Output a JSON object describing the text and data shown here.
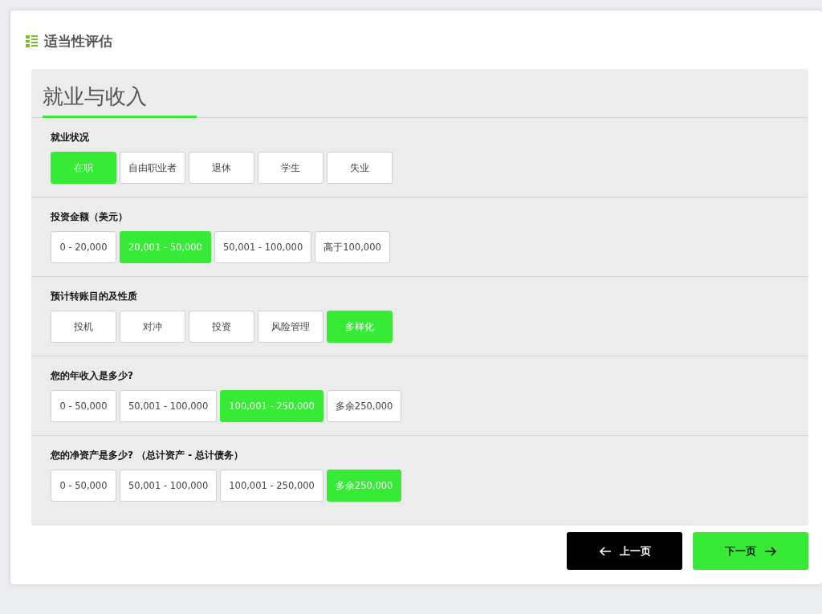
{
  "page": {
    "title": "适当性评估"
  },
  "panel": {
    "heading": "就业与收入"
  },
  "questions": [
    {
      "label": "就业状况",
      "options": [
        {
          "label": "在职",
          "selected": true
        },
        {
          "label": "自由职业者",
          "selected": false
        },
        {
          "label": "退休",
          "selected": false
        },
        {
          "label": "学生",
          "selected": false
        },
        {
          "label": "失业",
          "selected": false
        }
      ]
    },
    {
      "label": "投资金额（美元）",
      "options": [
        {
          "label": "0 - 20,000",
          "selected": false
        },
        {
          "label": "20,001 - 50,000",
          "selected": true
        },
        {
          "label": "50,001 - 100,000",
          "selected": false
        },
        {
          "label": "高于100,000",
          "selected": false
        }
      ]
    },
    {
      "label": "预计转账目的及性质",
      "options": [
        {
          "label": "投机",
          "selected": false
        },
        {
          "label": "对冲",
          "selected": false
        },
        {
          "label": "投资",
          "selected": false
        },
        {
          "label": "风险管理",
          "selected": false
        },
        {
          "label": "多样化",
          "selected": true
        }
      ]
    },
    {
      "label": "您的年收入是多少?",
      "options": [
        {
          "label": "0 - 50,000",
          "selected": false
        },
        {
          "label": "50,001 - 100,000",
          "selected": false
        },
        {
          "label": "100,001 - 250,000",
          "selected": true
        },
        {
          "label": "多余250,000",
          "selected": false
        }
      ]
    },
    {
      "label": "您的净资产是多少? （总计资产 - 总计债务）",
      "options": [
        {
          "label": "0 - 50,000",
          "selected": false
        },
        {
          "label": "50,001 - 100,000",
          "selected": false
        },
        {
          "label": "100,001 - 250,000",
          "selected": false
        },
        {
          "label": "多余250,000",
          "selected": true
        }
      ]
    }
  ],
  "navigation": [
    {
      "kind": "back",
      "label": "上一页"
    },
    {
      "kind": "next",
      "label": "下一页"
    }
  ]
}
